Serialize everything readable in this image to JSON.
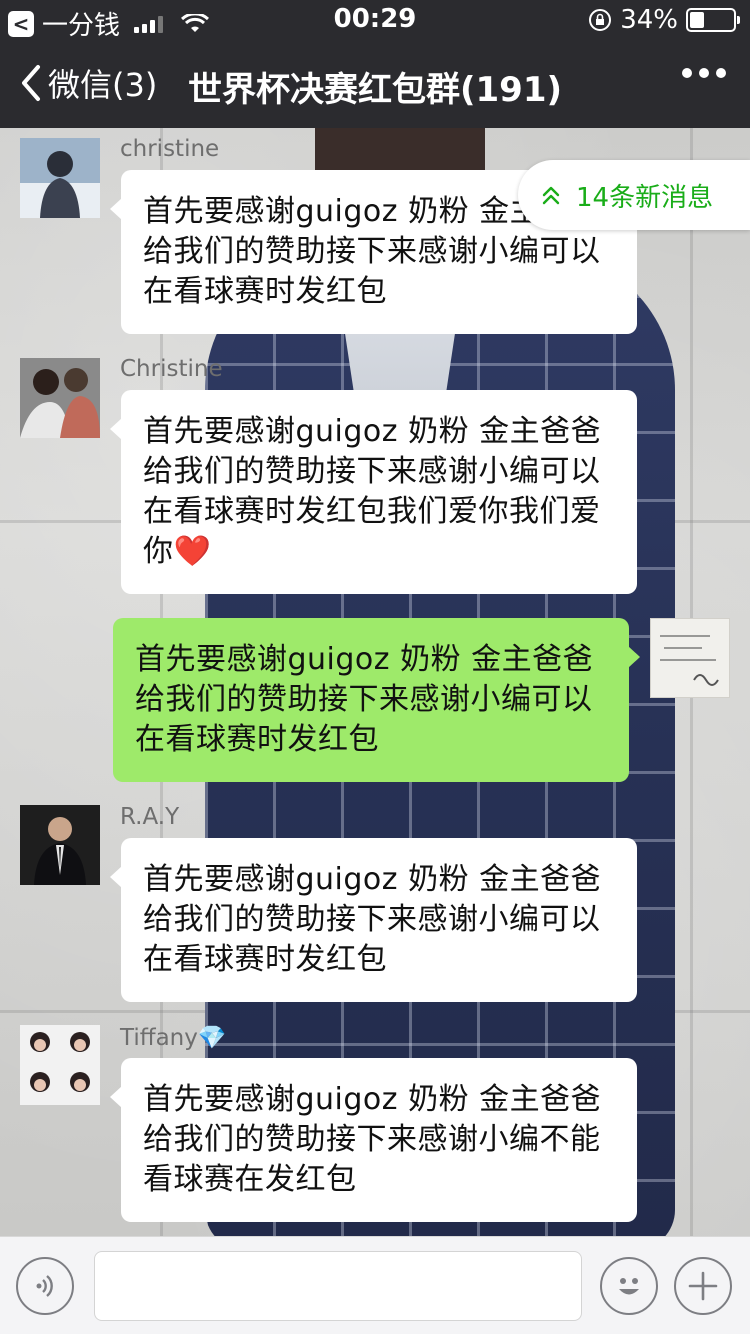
{
  "status_bar": {
    "back_app": "一分钱",
    "time": "00:29",
    "battery": "34%",
    "battery_level": 0.34
  },
  "nav": {
    "back_label": "微信(3)",
    "title": "世界杯决赛红包群(191)"
  },
  "new_messages_badge": "14条新消息",
  "messages": [
    {
      "sender": "christine",
      "side": "left",
      "text": "首先要感谢guigoz 奶粉 金主爸爸给我们的赞助接下来感谢小编可以在看球赛时发红包"
    },
    {
      "sender": "Christine",
      "side": "left",
      "text": "首先要感谢guigoz 奶粉 金主爸爸给我们的赞助接下来感谢小编可以在看球赛时发红包我们爱你我们爱你",
      "emoji": "❤️"
    },
    {
      "sender": "",
      "side": "right",
      "text": "首先要感谢guigoz 奶粉 金主爸爸给我们的赞助接下来感谢小编可以在看球赛时发红包"
    },
    {
      "sender": "R.A.Y",
      "side": "left",
      "text": "首先要感谢guigoz 奶粉 金主爸爸给我们的赞助接下来感谢小编可以在看球赛时发红包"
    },
    {
      "sender": "Tiffany",
      "sender_emoji": "💎",
      "side": "left",
      "text": "首先要感谢guigoz 奶粉 金主爸爸给我们的赞助接下来感谢小编不能看球赛在发红包"
    }
  ],
  "input": {
    "value": "",
    "placeholder": ""
  },
  "icons": {
    "voice": "voice-icon",
    "emoji": "emoji-icon",
    "plus": "plus-icon"
  },
  "colors": {
    "accent": "#1aad19",
    "my_bubble": "#9eea6a",
    "nav_bg": "#2b2b2f"
  }
}
